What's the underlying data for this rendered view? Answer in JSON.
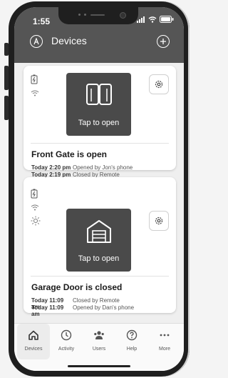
{
  "status": {
    "time": "1:55"
  },
  "header": {
    "title": "Devices"
  },
  "devices": [
    {
      "tile_label": "Tap to open",
      "state_text": "Front Gate is open",
      "log": [
        {
          "time": "Today 2:20 pm",
          "text": "Opened by Jon's phone"
        },
        {
          "time": "Today 2:19 pm",
          "text": "Closed by Remote"
        }
      ]
    },
    {
      "tile_label": "Tap to open",
      "state_text": "Garage Door is closed",
      "log": [
        {
          "time": "Today 11:09 am",
          "text": "Closed by Remote"
        },
        {
          "time": "Today 11:09 am",
          "text": "Opened by Dan's phone"
        }
      ]
    }
  ],
  "tabs": [
    {
      "label": "Devices",
      "icon": "home-icon",
      "active": true
    },
    {
      "label": "Activity",
      "icon": "clock-icon",
      "active": false
    },
    {
      "label": "Users",
      "icon": "users-icon",
      "active": false
    },
    {
      "label": "Help",
      "icon": "help-icon",
      "active": false
    },
    {
      "label": "More",
      "icon": "more-icon",
      "active": false
    }
  ],
  "colors": {
    "header_bg": "#555555",
    "tile_bg": "#4a4a4a",
    "screen_bg": "#efefef"
  }
}
